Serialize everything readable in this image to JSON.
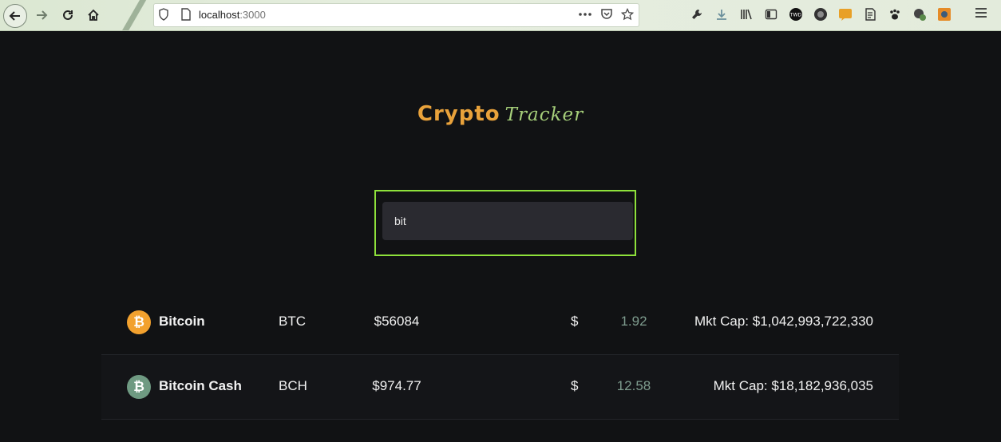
{
  "browser": {
    "url_host": "localhost",
    "url_port": ":3000"
  },
  "app": {
    "title_part1": "Crypto",
    "title_part2": "Tracker"
  },
  "search": {
    "value": "bit"
  },
  "coins": [
    {
      "name": "Bitcoin",
      "symbol": "BTC",
      "price": "$56084",
      "currency": "$",
      "change": "1.92",
      "market_cap": "Mkt Cap: $1,042,993,722,330",
      "icon": "bitcoin-icon",
      "icon_color": "#f2a12e"
    },
    {
      "name": "Bitcoin Cash",
      "symbol": "BCH",
      "price": "$974.77",
      "currency": "$",
      "change": "12.58",
      "market_cap": "Mkt Cap: $18,182,936,035",
      "icon": "bitcoin-cash-icon",
      "icon_color": "#6f9a82"
    }
  ],
  "colors": {
    "background": "#111214",
    "accent_orange": "#e9a23b",
    "accent_green": "#a6cf7a",
    "search_border": "#8ee13b",
    "change_text": "#7e9c8e"
  }
}
